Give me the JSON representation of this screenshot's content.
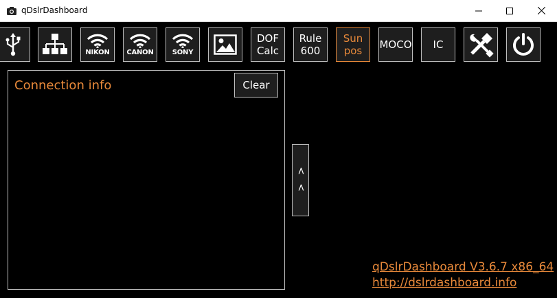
{
  "window": {
    "title": "qDslrDashboard",
    "controls": [
      "minimize-icon",
      "maximize-icon",
      "close-icon"
    ]
  },
  "toolbar": {
    "items": [
      {
        "name": "usb",
        "icon": "usb-icon"
      },
      {
        "name": "network",
        "icon": "network-icon"
      },
      {
        "name": "nikon",
        "icon": "wifi-icon",
        "label": "NIKON"
      },
      {
        "name": "canon",
        "icon": "wifi-icon",
        "label": "CANON"
      },
      {
        "name": "sony",
        "icon": "wifi-icon",
        "label": "SONY"
      },
      {
        "name": "image",
        "icon": "image-icon"
      },
      {
        "name": "dof-calc",
        "line1": "DOF",
        "line2": "Calc"
      },
      {
        "name": "rule-600",
        "line1": "Rule",
        "line2": "600"
      },
      {
        "name": "sun-pos",
        "line1": "Sun",
        "line2": "pos",
        "active": true
      },
      {
        "name": "moco",
        "label": "MOCO"
      },
      {
        "name": "ic",
        "label": "IC"
      },
      {
        "name": "tools",
        "icon": "tools-icon"
      },
      {
        "name": "power",
        "icon": "power-icon"
      }
    ]
  },
  "panel": {
    "title": "Connection info",
    "clear_label": "Clear"
  },
  "collapse": {
    "label": "< <"
  },
  "footer": {
    "version": "qDslrDashboard V3.6.7 x86_64",
    "url": "http://dslrdashboard.info"
  },
  "colors": {
    "accent": "#e8893a",
    "background": "#000000",
    "button_bg": "#1e1e1e",
    "button_border": "#bdbdbd"
  }
}
